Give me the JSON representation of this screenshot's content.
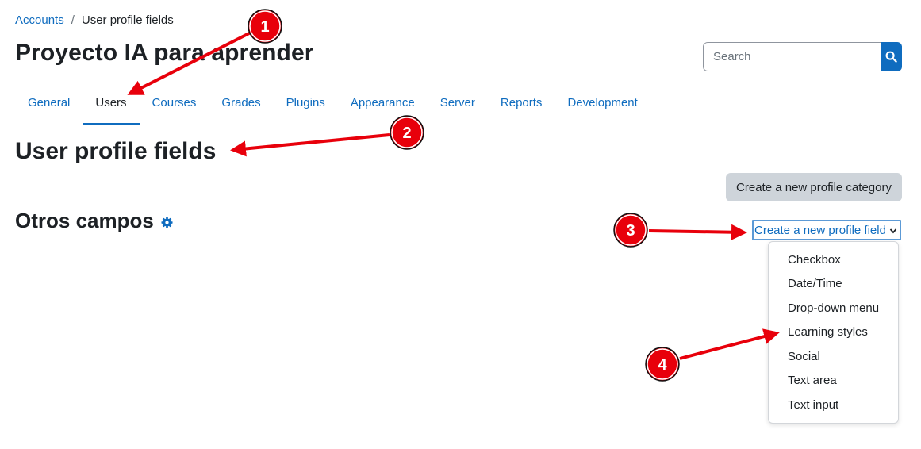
{
  "breadcrumb": {
    "parent": "Accounts",
    "separator": "/",
    "current": "User profile fields"
  },
  "site": {
    "title": "Proyecto IA para aprender"
  },
  "search": {
    "placeholder": "Search",
    "icon": "search-icon"
  },
  "nav": {
    "tabs": [
      {
        "label": "General",
        "active": false
      },
      {
        "label": "Users",
        "active": true
      },
      {
        "label": "Courses",
        "active": false
      },
      {
        "label": "Grades",
        "active": false
      },
      {
        "label": "Plugins",
        "active": false
      },
      {
        "label": "Appearance",
        "active": false
      },
      {
        "label": "Server",
        "active": false
      },
      {
        "label": "Reports",
        "active": false
      },
      {
        "label": "Development",
        "active": false
      }
    ]
  },
  "page": {
    "heading": "User profile fields",
    "create_category_label": "Create a new profile category"
  },
  "section": {
    "heading": "Otros campos",
    "icon": "gear-icon"
  },
  "field_select": {
    "selected": "Create a new profile field",
    "options": [
      "Checkbox",
      "Date/Time",
      "Drop-down menu",
      "Learning styles",
      "Social",
      "Text area",
      "Text input"
    ]
  },
  "annotations": {
    "badges": [
      "1",
      "2",
      "3",
      "4"
    ],
    "color": "#e8000b"
  },
  "colors": {
    "link": "#0f6cbf",
    "text": "#1d2125",
    "secondary_button": "#ced4da",
    "annotation": "#e8000b"
  }
}
